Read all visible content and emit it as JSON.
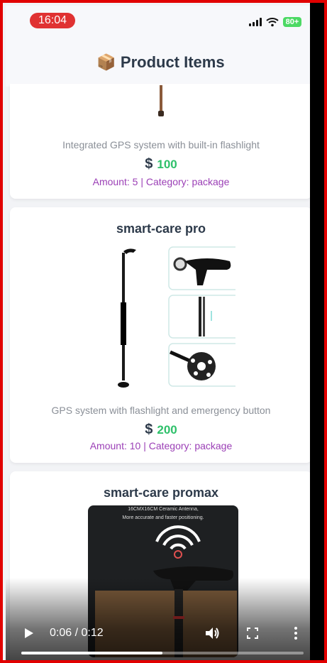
{
  "status_bar": {
    "time": "16:04",
    "battery": "80+"
  },
  "header": {
    "icon": "package-icon",
    "title": "📦 Product Items"
  },
  "products": [
    {
      "name": "",
      "description": "Integrated GPS system with built-in flashlight",
      "currency": "$",
      "price": "100",
      "meta": "Amount: 5 | Category: package"
    },
    {
      "name": "smart-care pro",
      "description": "GPS system with flashlight and emergency button",
      "currency": "$",
      "price": "200",
      "meta": "Amount: 10 | Category: package"
    },
    {
      "name": "smart-care promax",
      "image_caption_line1": "16CMX16CM Ceramic Antenna,",
      "image_caption_line2": "More accurate and faster positioning."
    }
  ],
  "video": {
    "time": "0:06 / 0:12",
    "progress": 0.5
  },
  "colors": {
    "accent_red": "#e03232",
    "price_green": "#2ec06a",
    "meta_purple": "#9b3fb6",
    "title_dark": "#2d3a4a"
  }
}
